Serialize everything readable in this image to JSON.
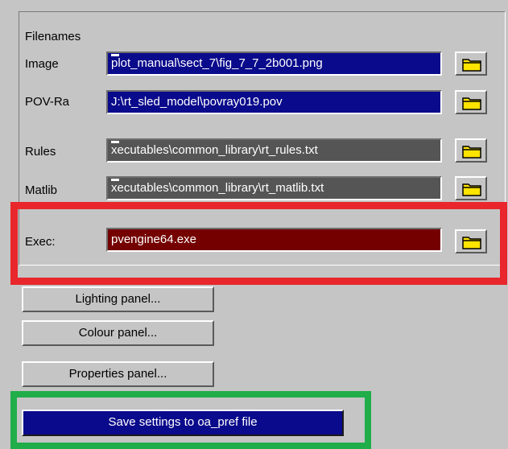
{
  "filenames": {
    "group_label": "Filenames",
    "rows": [
      {
        "label": "Image",
        "value": "plot_manual\\sect_7\\fig_7_7_2b001.png",
        "color": "#0a0a8c"
      },
      {
        "label": "POV-Ra",
        "value": "J:\\rt_sled_model\\povray019.pov",
        "color": "#0a0a8c"
      },
      {
        "label": "Rules",
        "value": "xecutables\\common_library\\rt_rules.txt",
        "color": "#555555"
      },
      {
        "label": "Matlib",
        "value": "xecutables\\common_library\\rt_matlib.txt",
        "color": "#555555"
      },
      {
        "label": "Exec:",
        "value": "pvengine64.exe",
        "color": "#740000"
      }
    ],
    "browse_icon": "folder-icon"
  },
  "panels": {
    "lighting_label": "Lighting panel...",
    "colour_label": "Colour panel...",
    "properties_label": "Properties panel..."
  },
  "save": {
    "label": "Save settings to oa_pref file"
  },
  "annotations": {
    "exec_highlight_color": "#e8262b",
    "save_highlight_color": "#20ad4a"
  }
}
